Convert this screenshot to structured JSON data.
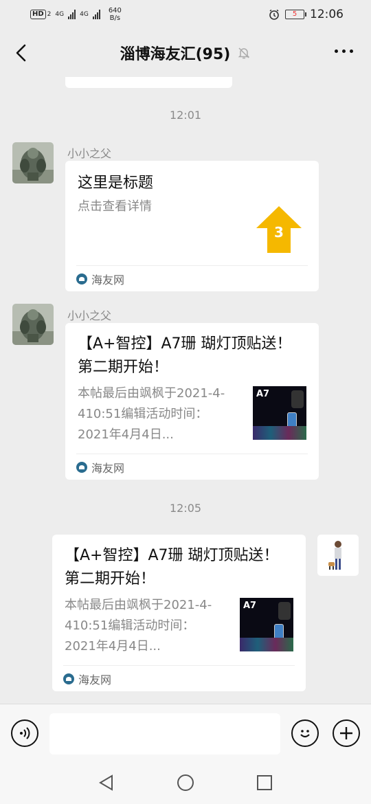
{
  "status_bar": {
    "hd_label": "HD",
    "hd_sub": "2",
    "net1": "4G",
    "net2": "4G",
    "speed_value": "640",
    "speed_unit": "B/s",
    "battery": "5",
    "time": "12:06"
  },
  "header": {
    "title": "淄博海友汇(95)",
    "mute_icon": "bell-muted-icon",
    "back_icon": "chevron-left-icon",
    "more_icon": "more-dots-icon"
  },
  "messages": [
    {
      "type": "timestamp",
      "text": "12:01"
    },
    {
      "type": "link_card",
      "side": "left",
      "sender": "小小之父",
      "title": "这里是标题",
      "description": "点击查看详情",
      "badge": "3",
      "source": "海友网"
    },
    {
      "type": "link_card",
      "side": "left",
      "sender": "小小之父",
      "title": "【A+智控】A7珊 瑚灯顶贴送！第二期开始！",
      "description": "本帖最后由飒枫于2021-4-410:51编辑活动时间：2021年4月4日...",
      "thumb_label": "A7",
      "source": "海友网"
    },
    {
      "type": "timestamp",
      "text": "12:05"
    },
    {
      "type": "link_card",
      "side": "right",
      "title": "【A+智控】A7珊 瑚灯顶贴送！第二期开始！",
      "description": "本帖最后由飒枫于2021-4-410:51编辑活动时间：2021年4月4日...",
      "thumb_label": "A7",
      "source": "海友网"
    }
  ],
  "input_bar": {
    "voice_icon": "voice-icon",
    "emoji_icon": "emoji-icon",
    "plus_icon": "plus-icon"
  },
  "system_nav": [
    "back-triangle-icon",
    "home-circle-icon",
    "recents-square-icon"
  ],
  "colors": {
    "background": "#ededed",
    "card": "#ffffff",
    "badge": "#f5b800",
    "muted_text": "#888888"
  }
}
